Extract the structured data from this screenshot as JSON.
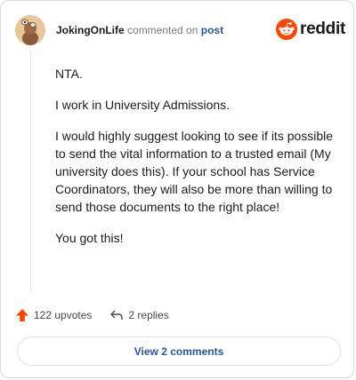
{
  "header": {
    "username": "JokingOnLife",
    "action_text": "commented on",
    "post_link": "post"
  },
  "logo": {
    "text": "reddit",
    "color": "#ff4500"
  },
  "comment": {
    "paragraphs": [
      "NTA.",
      "I work in University Admissions.",
      "I would highly suggest looking to see if its possible to send the vital information to a trusted email (My university does this). If your school has Service Coordinators, they will also be more than willing to send those documents to the right place!",
      "You got this!"
    ]
  },
  "actions": {
    "upvotes": "122 upvotes",
    "replies": "2 replies"
  },
  "view_comments_label": "View 2 comments",
  "icons": {
    "upvote": "upvote-arrow-icon",
    "reply": "reply-arrow-icon",
    "logo": "reddit-snoo-icon"
  }
}
